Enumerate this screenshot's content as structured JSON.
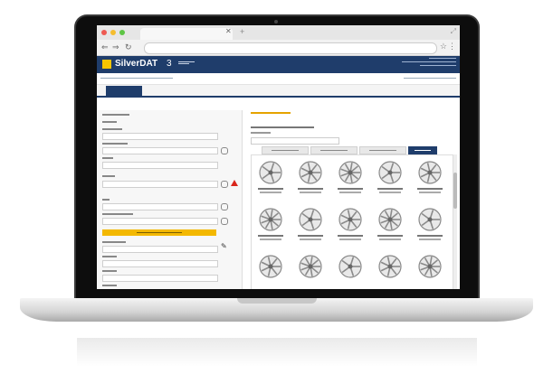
{
  "app": {
    "brand": "SilverDAT",
    "version": "3"
  },
  "main_tabs": [
    {
      "id": "t1",
      "active": true
    },
    {
      "id": "t2",
      "active": false
    },
    {
      "id": "t3",
      "active": false
    },
    {
      "id": "t4",
      "active": false
    },
    {
      "id": "t5",
      "active": false
    }
  ],
  "colors": {
    "brand_navy": "#1f3d6b",
    "accent_yellow": "#f3b800",
    "warning_red": "#d9261c"
  },
  "icons": [
    "close-icon",
    "plus-icon",
    "back-arrow-icon",
    "forward-arrow-icon",
    "reload-icon",
    "star-icon",
    "kebab-menu-icon",
    "logo-icon",
    "warning-icon",
    "pencil-icon",
    "wheel-rim-icon"
  ],
  "wheel_rows": 3,
  "wheel_cols": 5
}
